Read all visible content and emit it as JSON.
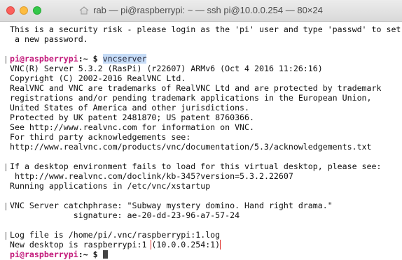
{
  "window": {
    "title": "rab — pi@raspberrypi: ~ — ssh pi@10.0.0.254 — 80×24"
  },
  "terminal": {
    "lines": [
      "This is a security risk - please login as the 'pi' user and type 'passwd' to set",
      " a new password.",
      "",
      "",
      "VNC(R) Server 5.3.2 (RasPi) (r22607) ARMv6 (Oct 4 2016 11:26:16)",
      "Copyright (C) 2002-2016 RealVNC Ltd.",
      "RealVNC and VNC are trademarks of RealVNC Ltd and are protected by trademark",
      "registrations and/or pending trademark applications in the European Union,",
      "United States of America and other jurisdictions.",
      "Protected by UK patent 2481870; US patent 8760366.",
      "See http://www.realvnc.com for information on VNC.",
      "For third party acknowledgements see:",
      "http://www.realvnc.com/products/vnc/documentation/5.3/acknowledgements.txt",
      "",
      "If a desktop environment fails to load for this virtual desktop, please see:",
      " http://www.realvnc.com/doclink/kb-345?version=5.3.2.22607",
      "Running applications in /etc/vnc/xstartup",
      "",
      "VNC Server catchphrase: \"Subway mystery domino. Hand right drama.\"",
      "             signature: ae-20-dd-23-96-a7-57-24",
      "",
      "Log file is /home/pi/.vnc/raspberrypi:1.log"
    ],
    "prompt_user": "pi@raspberrypi",
    "prompt_sep": ":~ $ ",
    "command": "vncserver",
    "new_desktop_prefix": "New desktop is raspberrypi:1 ",
    "new_desktop_addr": "(10.0.0.254:1)"
  }
}
